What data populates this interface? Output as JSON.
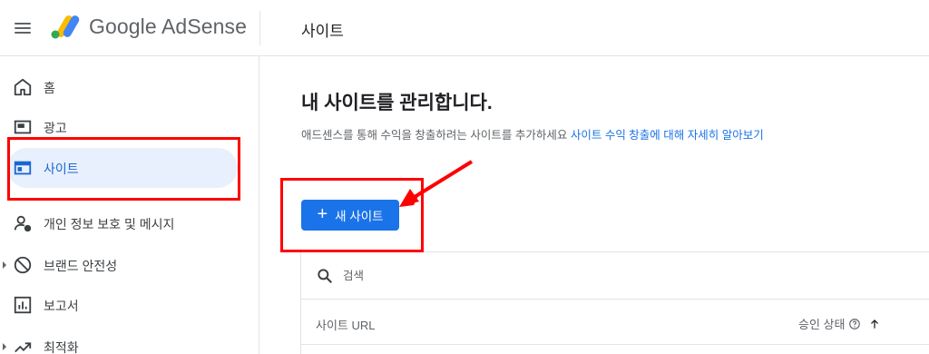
{
  "header": {
    "brand_name": "Google AdSense",
    "page_title": "사이트"
  },
  "sidebar": {
    "items": [
      {
        "label": "홈",
        "icon": "home-icon"
      },
      {
        "label": "광고",
        "icon": "ads-icon"
      },
      {
        "label": "사이트",
        "icon": "sites-icon",
        "active": true
      },
      {
        "label": "개인 정보 보호 및 메시지",
        "icon": "privacy-icon"
      },
      {
        "label": "브랜드 안전성",
        "icon": "block-icon"
      },
      {
        "label": "보고서",
        "icon": "reports-icon"
      },
      {
        "label": "최적화",
        "icon": "trending-icon"
      }
    ]
  },
  "main": {
    "title": "내 사이트를 관리합니다.",
    "description": "애드센스를 통해 수익을 창출하려는 사이트를 추가하세요",
    "learn_more_link": "사이트 수익 창출에 대해 자세히 알아보기",
    "new_site_button": "새 사이트",
    "search": {
      "placeholder": "검색",
      "value": ""
    },
    "table": {
      "columns": {
        "url": "사이트 URL",
        "status": "승인 상태"
      }
    }
  },
  "colors": {
    "accent": "#1a73e8",
    "active_nav_bg": "#e8f0fe",
    "annotation_red": "#ff0000"
  }
}
